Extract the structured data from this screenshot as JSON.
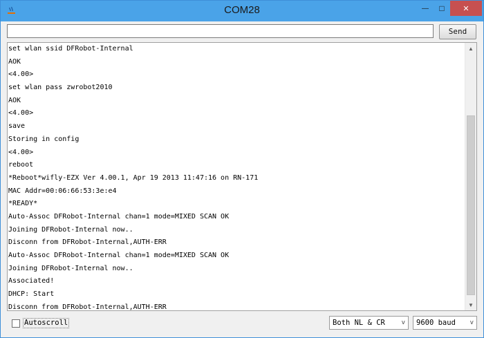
{
  "window": {
    "title": "COM28",
    "minimize_glyph": "—",
    "maximize_glyph": "□",
    "close_glyph": "✕"
  },
  "send": {
    "input_value": "",
    "button_label": "Send"
  },
  "output": {
    "lines": [
      "set wlan ssid DFRobot-Internal",
      "AOK",
      "<4.00>",
      "set wlan pass zwrobot2010",
      "AOK",
      "<4.00>",
      "save",
      "Storing in config",
      "<4.00>",
      "reboot",
      "*Reboot*wifly-EZX Ver 4.00.1, Apr 19 2013 11:47:16 on RN-171",
      "MAC Addr=00:06:66:53:3e:e4",
      "*READY*",
      "Auto-Assoc DFRobot-Internal chan=1 mode=MIXED SCAN OK",
      "Joining DFRobot-Internal now..",
      "Disconn from DFRobot-Internal,AUTH-ERR",
      "Auto-Assoc DFRobot-Internal chan=1 mode=MIXED SCAN OK",
      "Joining DFRobot-Internal now..",
      "Associated!",
      "DHCP: Start",
      "Disconn from DFRobot-Internal,AUTH-ERR"
    ],
    "scroll_up_glyph": "▲",
    "scroll_down_glyph": "▼"
  },
  "footer": {
    "autoscroll_label": "Autoscroll",
    "autoscroll_checked": false,
    "line_ending": "Both NL & CR",
    "baud_rate": "9600 baud",
    "dropdown_glyph": "v"
  }
}
